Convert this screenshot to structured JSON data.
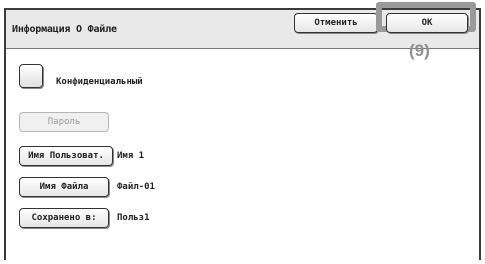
{
  "dialog": {
    "title": "Информация О Файле",
    "cancel_label": "Отменить",
    "ok_label": "ОК",
    "callout": "(9)"
  },
  "confidential": {
    "label": "Конфиденциальный",
    "checked": false
  },
  "password": {
    "label": "Пароль",
    "enabled": false
  },
  "fields": {
    "user": {
      "button_label": "Имя Пользоват.",
      "value": "Имя 1"
    },
    "file": {
      "button_label": "Имя Файла",
      "value": "Файл-01"
    },
    "saved_to": {
      "button_label": "Сохранено в:",
      "value": "Польз1"
    }
  }
}
